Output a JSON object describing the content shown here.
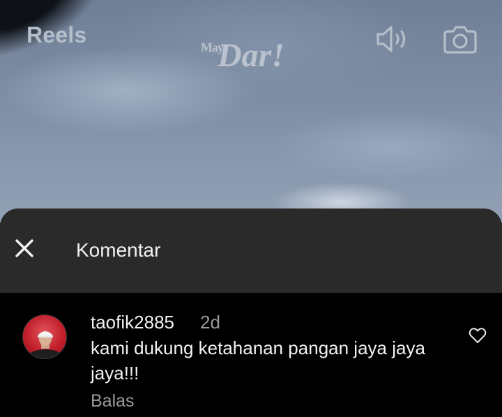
{
  "video": {
    "title": "Reels",
    "watermark_small": "May",
    "watermark_big": "Dar!",
    "icons": {
      "sound": "speaker-icon",
      "camera": "camera-icon"
    }
  },
  "sheet": {
    "title": "Komentar",
    "close_icon": "close-icon"
  },
  "comments": [
    {
      "username": "taofik2885",
      "time": "2d",
      "text": "kami dukung ketahanan pangan jaya jaya jaya!!!",
      "reply_label": "Balas",
      "like_icon": "heart-icon"
    }
  ],
  "colors": {
    "sheet_header_bg": "#2a2a2b",
    "list_bg": "#000000",
    "text_primary": "#f2f2f2",
    "text_secondary": "#9a9a9a"
  }
}
